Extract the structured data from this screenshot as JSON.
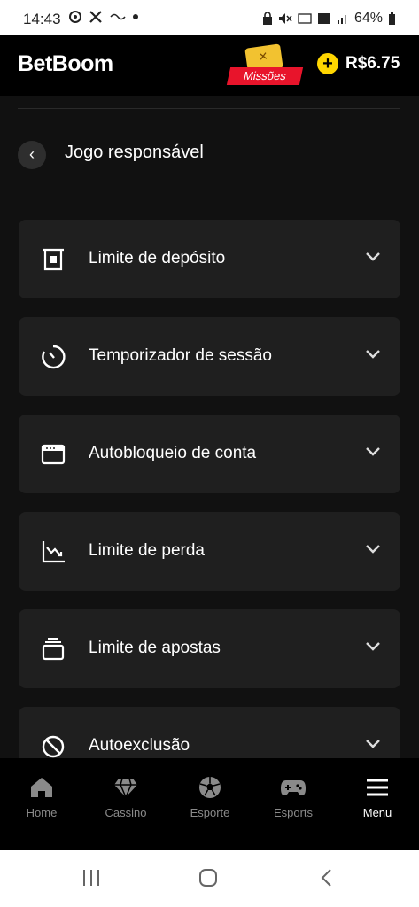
{
  "status_bar": {
    "time": "14:43",
    "battery": "64%"
  },
  "header": {
    "logo": "BetBoom",
    "missions_label": "Missões",
    "balance": "R$6.75"
  },
  "page": {
    "title": "Jogo responsável"
  },
  "items": [
    {
      "label": "Limite de depósito",
      "icon": "deposit-limit-icon"
    },
    {
      "label": "Temporizador de sessão",
      "icon": "timer-icon"
    },
    {
      "label": "Autobloqueio de conta",
      "icon": "account-block-icon"
    },
    {
      "label": "Limite de perda",
      "icon": "loss-chart-icon"
    },
    {
      "label": "Limite de apostas",
      "icon": "bets-stack-icon"
    },
    {
      "label": "Autoexclusão",
      "icon": "prohibited-icon"
    }
  ],
  "bottom_nav": [
    {
      "label": "Home",
      "icon": "home-icon",
      "active": false
    },
    {
      "label": "Cassino",
      "icon": "diamond-icon",
      "active": false
    },
    {
      "label": "Esporte",
      "icon": "soccer-ball-icon",
      "active": false
    },
    {
      "label": "Esports",
      "icon": "gamepad-icon",
      "active": false
    },
    {
      "label": "Menu",
      "icon": "hamburger-menu-icon",
      "active": true
    }
  ],
  "colors": {
    "accent_yellow": "#ffd600",
    "missions_red": "#e8142b",
    "card_bg": "#1f1f1f",
    "bg": "#111111"
  }
}
